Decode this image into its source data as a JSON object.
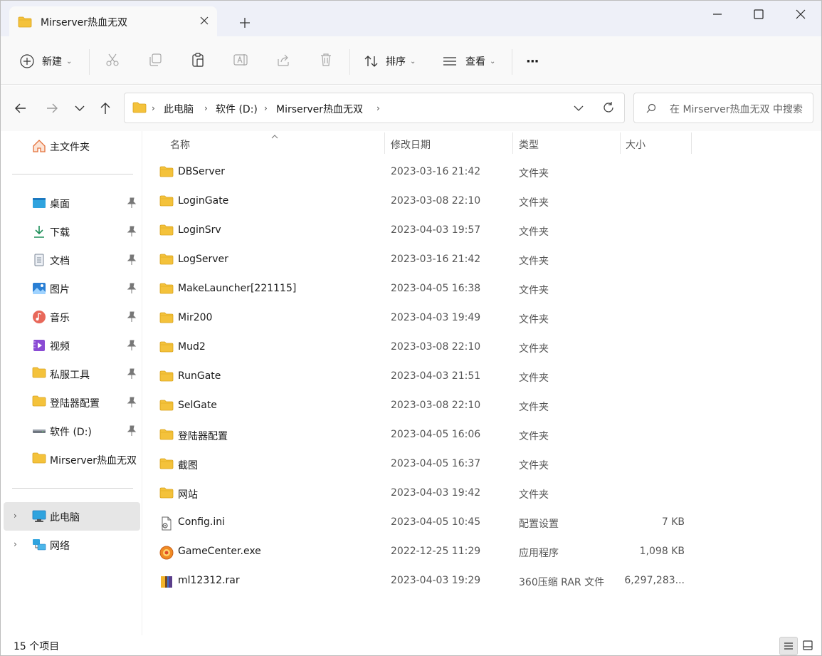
{
  "tab": {
    "title": "Mirserver热血无双"
  },
  "toolbar": {
    "new_label": "新建",
    "sort_label": "排序",
    "view_label": "查看",
    "more_label": "···"
  },
  "address": {
    "crumbs": [
      "此电脑",
      "软件 (D:)",
      "Mirserver热血无双"
    ]
  },
  "search": {
    "placeholder": "在 Mirserver热血无双 中搜索"
  },
  "sidebar": {
    "home": "主文件夹",
    "pinned": [
      {
        "label": "桌面",
        "icon": "desktop-icon"
      },
      {
        "label": "下载",
        "icon": "download-icon"
      },
      {
        "label": "文档",
        "icon": "document-icon"
      },
      {
        "label": "图片",
        "icon": "pictures-icon"
      },
      {
        "label": "音乐",
        "icon": "music-icon"
      },
      {
        "label": "视频",
        "icon": "video-icon"
      },
      {
        "label": "私服工具",
        "icon": "folder-icon"
      },
      {
        "label": "登陆器配置",
        "icon": "folder-icon"
      },
      {
        "label": "软件 (D:)",
        "icon": "drive-icon"
      }
    ],
    "recent_folder": "Mirserver热血无双",
    "this_pc": "此电脑",
    "network": "网络"
  },
  "columns": {
    "name": "名称",
    "date": "修改日期",
    "type": "类型",
    "size": "大小"
  },
  "files": [
    {
      "name": "DBServer",
      "date": "2023-03-16 21:42",
      "type": "文件夹",
      "size": "",
      "icon": "folder-icon"
    },
    {
      "name": "LoginGate",
      "date": "2023-03-08 22:10",
      "type": "文件夹",
      "size": "",
      "icon": "folder-icon"
    },
    {
      "name": "LoginSrv",
      "date": "2023-04-03 19:57",
      "type": "文件夹",
      "size": "",
      "icon": "folder-icon"
    },
    {
      "name": "LogServer",
      "date": "2023-03-16 21:42",
      "type": "文件夹",
      "size": "",
      "icon": "folder-icon"
    },
    {
      "name": "MakeLauncher[221115]",
      "date": "2023-04-05 16:38",
      "type": "文件夹",
      "size": "",
      "icon": "folder-icon"
    },
    {
      "name": "Mir200",
      "date": "2023-04-03 19:49",
      "type": "文件夹",
      "size": "",
      "icon": "folder-icon"
    },
    {
      "name": "Mud2",
      "date": "2023-03-08 22:10",
      "type": "文件夹",
      "size": "",
      "icon": "folder-icon"
    },
    {
      "name": "RunGate",
      "date": "2023-04-03 21:51",
      "type": "文件夹",
      "size": "",
      "icon": "folder-icon"
    },
    {
      "name": "SelGate",
      "date": "2023-03-08 22:10",
      "type": "文件夹",
      "size": "",
      "icon": "folder-icon"
    },
    {
      "name": "登陆器配置",
      "date": "2023-04-05 16:06",
      "type": "文件夹",
      "size": "",
      "icon": "folder-icon"
    },
    {
      "name": "截图",
      "date": "2023-04-05 16:37",
      "type": "文件夹",
      "size": "",
      "icon": "folder-icon"
    },
    {
      "name": "网站",
      "date": "2023-04-03 19:42",
      "type": "文件夹",
      "size": "",
      "icon": "folder-icon"
    },
    {
      "name": "Config.ini",
      "date": "2023-04-05 10:45",
      "type": "配置设置",
      "size": "7 KB",
      "icon": "ini-file-icon"
    },
    {
      "name": "GameCenter.exe",
      "date": "2022-12-25 11:29",
      "type": "应用程序",
      "size": "1,098 KB",
      "icon": "exe-file-icon"
    },
    {
      "name": "ml12312.rar",
      "date": "2023-04-03 19:29",
      "type": "360压缩 RAR 文件",
      "size": "6,297,283...",
      "icon": "rar-file-icon"
    }
  ],
  "status": {
    "count": "15 个项目"
  },
  "colors": {
    "folder": "#f4c23b",
    "selected_bg": "#e6e6e6",
    "accent": "#0067c0"
  }
}
